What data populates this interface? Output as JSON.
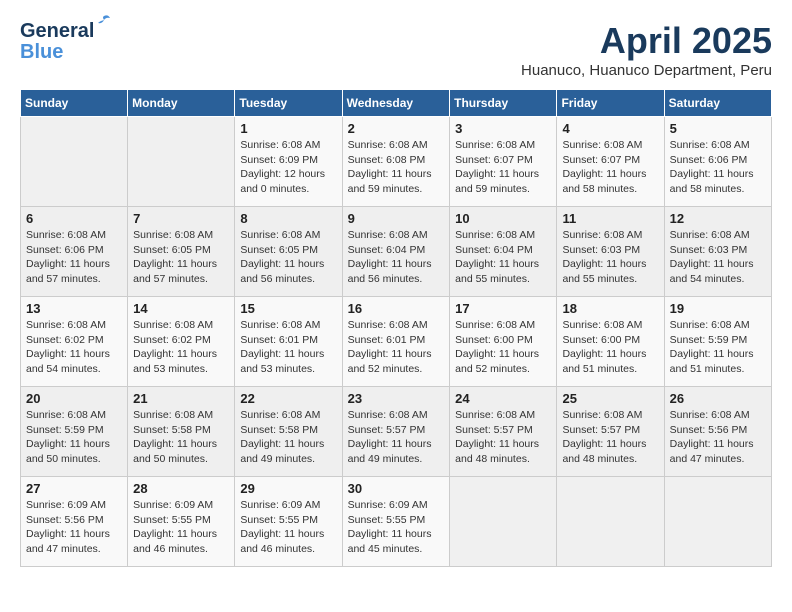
{
  "header": {
    "logo_general": "General",
    "logo_blue": "Blue",
    "month": "April 2025",
    "location": "Huanuco, Huanuco Department, Peru"
  },
  "days_of_week": [
    "Sunday",
    "Monday",
    "Tuesday",
    "Wednesday",
    "Thursday",
    "Friday",
    "Saturday"
  ],
  "weeks": [
    [
      {
        "day": "",
        "info": ""
      },
      {
        "day": "",
        "info": ""
      },
      {
        "day": "1",
        "info": "Sunrise: 6:08 AM\nSunset: 6:09 PM\nDaylight: 12 hours\nand 0 minutes."
      },
      {
        "day": "2",
        "info": "Sunrise: 6:08 AM\nSunset: 6:08 PM\nDaylight: 11 hours\nand 59 minutes."
      },
      {
        "day": "3",
        "info": "Sunrise: 6:08 AM\nSunset: 6:07 PM\nDaylight: 11 hours\nand 59 minutes."
      },
      {
        "day": "4",
        "info": "Sunrise: 6:08 AM\nSunset: 6:07 PM\nDaylight: 11 hours\nand 58 minutes."
      },
      {
        "day": "5",
        "info": "Sunrise: 6:08 AM\nSunset: 6:06 PM\nDaylight: 11 hours\nand 58 minutes."
      }
    ],
    [
      {
        "day": "6",
        "info": "Sunrise: 6:08 AM\nSunset: 6:06 PM\nDaylight: 11 hours\nand 57 minutes."
      },
      {
        "day": "7",
        "info": "Sunrise: 6:08 AM\nSunset: 6:05 PM\nDaylight: 11 hours\nand 57 minutes."
      },
      {
        "day": "8",
        "info": "Sunrise: 6:08 AM\nSunset: 6:05 PM\nDaylight: 11 hours\nand 56 minutes."
      },
      {
        "day": "9",
        "info": "Sunrise: 6:08 AM\nSunset: 6:04 PM\nDaylight: 11 hours\nand 56 minutes."
      },
      {
        "day": "10",
        "info": "Sunrise: 6:08 AM\nSunset: 6:04 PM\nDaylight: 11 hours\nand 55 minutes."
      },
      {
        "day": "11",
        "info": "Sunrise: 6:08 AM\nSunset: 6:03 PM\nDaylight: 11 hours\nand 55 minutes."
      },
      {
        "day": "12",
        "info": "Sunrise: 6:08 AM\nSunset: 6:03 PM\nDaylight: 11 hours\nand 54 minutes."
      }
    ],
    [
      {
        "day": "13",
        "info": "Sunrise: 6:08 AM\nSunset: 6:02 PM\nDaylight: 11 hours\nand 54 minutes."
      },
      {
        "day": "14",
        "info": "Sunrise: 6:08 AM\nSunset: 6:02 PM\nDaylight: 11 hours\nand 53 minutes."
      },
      {
        "day": "15",
        "info": "Sunrise: 6:08 AM\nSunset: 6:01 PM\nDaylight: 11 hours\nand 53 minutes."
      },
      {
        "day": "16",
        "info": "Sunrise: 6:08 AM\nSunset: 6:01 PM\nDaylight: 11 hours\nand 52 minutes."
      },
      {
        "day": "17",
        "info": "Sunrise: 6:08 AM\nSunset: 6:00 PM\nDaylight: 11 hours\nand 52 minutes."
      },
      {
        "day": "18",
        "info": "Sunrise: 6:08 AM\nSunset: 6:00 PM\nDaylight: 11 hours\nand 51 minutes."
      },
      {
        "day": "19",
        "info": "Sunrise: 6:08 AM\nSunset: 5:59 PM\nDaylight: 11 hours\nand 51 minutes."
      }
    ],
    [
      {
        "day": "20",
        "info": "Sunrise: 6:08 AM\nSunset: 5:59 PM\nDaylight: 11 hours\nand 50 minutes."
      },
      {
        "day": "21",
        "info": "Sunrise: 6:08 AM\nSunset: 5:58 PM\nDaylight: 11 hours\nand 50 minutes."
      },
      {
        "day": "22",
        "info": "Sunrise: 6:08 AM\nSunset: 5:58 PM\nDaylight: 11 hours\nand 49 minutes."
      },
      {
        "day": "23",
        "info": "Sunrise: 6:08 AM\nSunset: 5:57 PM\nDaylight: 11 hours\nand 49 minutes."
      },
      {
        "day": "24",
        "info": "Sunrise: 6:08 AM\nSunset: 5:57 PM\nDaylight: 11 hours\nand 48 minutes."
      },
      {
        "day": "25",
        "info": "Sunrise: 6:08 AM\nSunset: 5:57 PM\nDaylight: 11 hours\nand 48 minutes."
      },
      {
        "day": "26",
        "info": "Sunrise: 6:08 AM\nSunset: 5:56 PM\nDaylight: 11 hours\nand 47 minutes."
      }
    ],
    [
      {
        "day": "27",
        "info": "Sunrise: 6:09 AM\nSunset: 5:56 PM\nDaylight: 11 hours\nand 47 minutes."
      },
      {
        "day": "28",
        "info": "Sunrise: 6:09 AM\nSunset: 5:55 PM\nDaylight: 11 hours\nand 46 minutes."
      },
      {
        "day": "29",
        "info": "Sunrise: 6:09 AM\nSunset: 5:55 PM\nDaylight: 11 hours\nand 46 minutes."
      },
      {
        "day": "30",
        "info": "Sunrise: 6:09 AM\nSunset: 5:55 PM\nDaylight: 11 hours\nand 45 minutes."
      },
      {
        "day": "",
        "info": ""
      },
      {
        "day": "",
        "info": ""
      },
      {
        "day": "",
        "info": ""
      }
    ]
  ]
}
